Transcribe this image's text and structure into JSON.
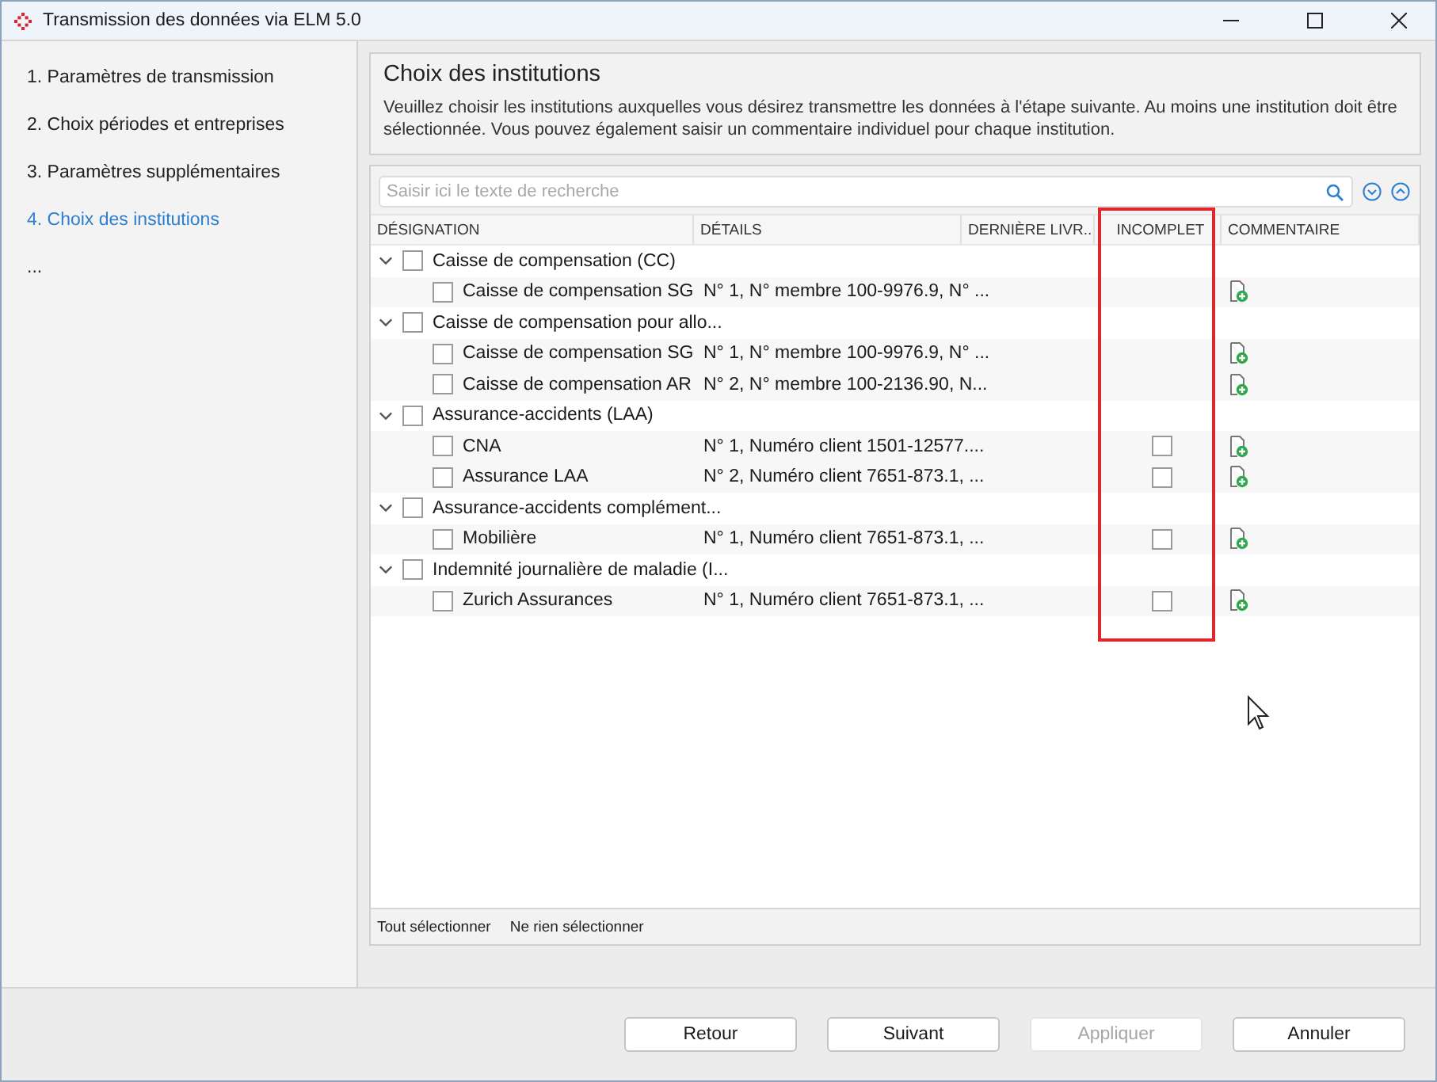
{
  "window": {
    "title": "Transmission des données via ELM 5.0"
  },
  "sidebar": {
    "items": [
      {
        "label": "1. Paramètres de transmission",
        "selected": false
      },
      {
        "label": "2. Choix périodes et entreprises",
        "selected": false
      },
      {
        "label": "3. Paramètres supplémentaires",
        "selected": false
      },
      {
        "label": "4. Choix des institutions",
        "selected": true
      },
      {
        "label": "...",
        "selected": false
      }
    ]
  },
  "header": {
    "title": "Choix des institutions",
    "description": "Veuillez choisir les institutions auxquelles vous désirez transmettre les données à l'étape suivante. Au moins une institution doit être sélectionnée. Vous pouvez également saisir un commentaire individuel pour chaque institution."
  },
  "search": {
    "placeholder": "Saisir ici le texte de recherche"
  },
  "table": {
    "columns": [
      "DÉSIGNATION",
      "DÉTAILS",
      "DERNIÈRE LIVR...",
      "INCOMPLET",
      "COMMENTAIRE"
    ],
    "groups": [
      {
        "label": "Caisse de compensation (CC)",
        "checked": false,
        "expanded": true,
        "children": [
          {
            "label": "Caisse de compensation SG",
            "checked": false,
            "details": "N° 1, N° membre 100-9976.9, N° ..."
          }
        ]
      },
      {
        "label": "Caisse de compensation pour allo...",
        "checked": false,
        "expanded": true,
        "children": [
          {
            "label": "Caisse de compensation SG",
            "checked": false,
            "details": "N° 1, N° membre 100-9976.9, N° ..."
          },
          {
            "label": "Caisse de compensation AR",
            "checked": false,
            "details": "N° 2, N° membre 100-2136.90, N..."
          }
        ]
      },
      {
        "label": "Assurance-accidents (LAA)",
        "checked": false,
        "expanded": true,
        "children": [
          {
            "label": "CNA",
            "checked": false,
            "details": "N° 1, Numéro client 1501-12577....",
            "incomplete": false
          },
          {
            "label": "Assurance LAA",
            "checked": false,
            "details": "N° 2, Numéro client 7651-873.1, ...",
            "incomplete": false
          }
        ]
      },
      {
        "label": "Assurance-accidents complément...",
        "checked": false,
        "expanded": true,
        "children": [
          {
            "label": "Mobilière",
            "checked": false,
            "details": "N° 1, Numéro client 7651-873.1, ...",
            "incomplete": false
          }
        ]
      },
      {
        "label": "Indemnité journalière de maladie (I...",
        "checked": false,
        "expanded": true,
        "children": [
          {
            "label": "Zurich Assurances",
            "checked": false,
            "details": "N° 1, Numéro client 7651-873.1, ...",
            "incomplete": false
          }
        ]
      }
    ]
  },
  "table_footer": [
    "Tout sélectionner",
    "Ne rien sélectionner"
  ],
  "buttons": [
    {
      "label": "Retour",
      "disabled": false
    },
    {
      "label": "Suivant",
      "disabled": false
    },
    {
      "label": "Appliquer",
      "disabled": true
    },
    {
      "label": "Annuler",
      "disabled": false
    }
  ]
}
